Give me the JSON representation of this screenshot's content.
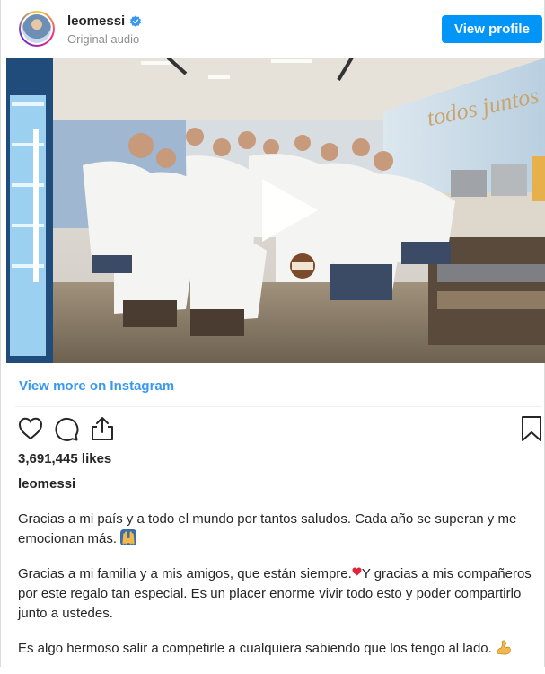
{
  "header": {
    "username": "leomessi",
    "subtitle": "Original audio",
    "view_profile_label": "View profile"
  },
  "post": {
    "view_more_label": "View more on Instagram",
    "likes": "3,691,445 likes",
    "caption_username": "leomessi",
    "caption": {
      "p1": "Gracias a mi país y a todo el mundo por tantos saludos. Cada año se superan y me emocionan más.",
      "p2a": "Gracias a mi familia y a mis amigos, que están siempre.",
      "p2b": "Y gracias a mis compañeros por este regalo tan especial. Es un placer enorme vivir todo esto y poder compartirlo junto a ustedes.",
      "p3": "Es algo hermoso salir a competirle a cualquiera sabiendo que los tengo al lado."
    },
    "wall_text": "todos juntos"
  },
  "icons": {
    "verified": "verified-badge-icon",
    "play": "play-icon",
    "like": "heart-icon",
    "comment": "comment-icon",
    "share": "share-icon",
    "save": "bookmark-icon",
    "emoji_1": "raised-hands-emoji",
    "emoji_2": "red-heart-emoji",
    "emoji_3": "flexed-biceps-emoji"
  },
  "colors": {
    "accent": "#0095f6",
    "link": "#3897f0",
    "text": "#262626",
    "muted": "#8e8e8e"
  }
}
